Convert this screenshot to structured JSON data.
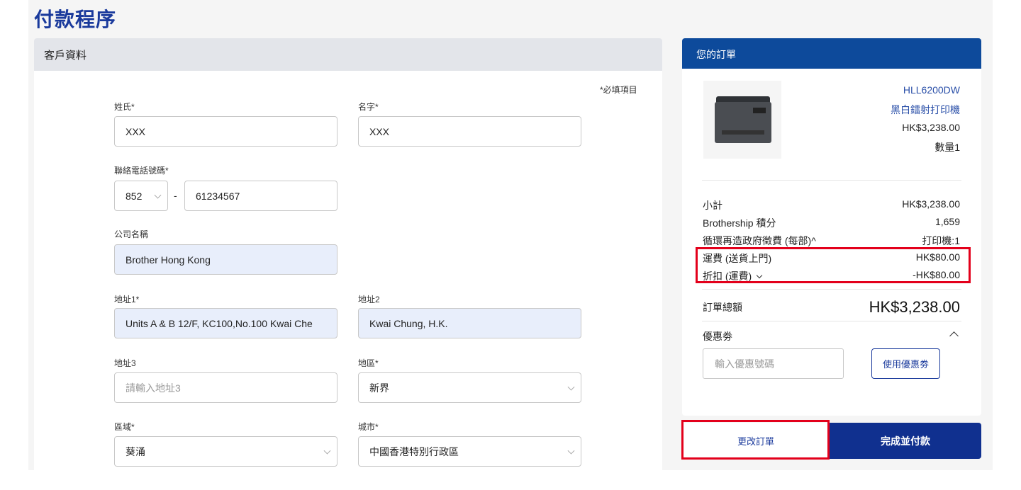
{
  "page": {
    "title": "付款程序"
  },
  "customer": {
    "header": "客戶資料",
    "required_note": "*必填項目",
    "surname": {
      "label": "姓氏*",
      "value": "XXX"
    },
    "given_name": {
      "label": "名字*",
      "value": "XXX"
    },
    "phone": {
      "label": "聯絡電話號碼*",
      "country_code": "852",
      "separator": "-",
      "number": "61234567"
    },
    "company": {
      "label": "公司名稱",
      "value": "Brother Hong Kong"
    },
    "address1": {
      "label": "地址1*",
      "value": "Units A & B 12/F, KC100,No.100 Kwai Che"
    },
    "address2": {
      "label": "地址2",
      "value": "Kwai Chung,  H.K."
    },
    "address3": {
      "label": "地址3",
      "placeholder": "請輸入地址3"
    },
    "region": {
      "label": "地區*",
      "value": "新界"
    },
    "district": {
      "label": "區域*",
      "value": "葵涌"
    },
    "city": {
      "label": "城市*",
      "value": "中國香港特別行政區"
    }
  },
  "order": {
    "header": "您的訂單",
    "product": {
      "model": "HLL6200DW",
      "name": "黑白鐳射打印機",
      "price": "HK$3,238.00",
      "quantity": "數量1",
      "image_icon": "laser-printer"
    },
    "summary": [
      {
        "label": "小計",
        "value": "HK$3,238.00"
      },
      {
        "label": "Brothership 積分",
        "value": "1,659"
      },
      {
        "label": "循環再造政府徵費 (每部)^",
        "value": "打印機:1"
      },
      {
        "label": "運費 (送貨上門)",
        "value": "HK$80.00"
      },
      {
        "label": "折扣 (運費)",
        "value": "-HK$80.00"
      }
    ],
    "total": {
      "label": "訂單總額",
      "value": "HK$3,238.00"
    },
    "coupon": {
      "label": "優惠劵",
      "placeholder": "輸入優惠號碼",
      "apply_label": "使用優惠劵"
    }
  },
  "actions": {
    "change_order": "更改訂單",
    "complete_payment": "完成並付款"
  },
  "colors": {
    "brand_blue": "#10308f",
    "header_blue": "#0d4a9b",
    "highlight_red": "#e3001b"
  }
}
